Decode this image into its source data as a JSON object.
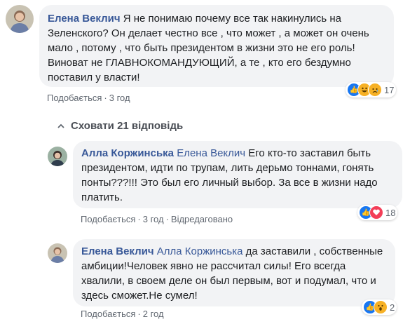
{
  "comments": [
    {
      "author": "Елена Веклич",
      "text": "Я не понимаю почему все так накинулись на Зеленского? Он делает честно все , что может , а может он очень мало , потому , что быть президентом в жизни это не его роль!Виноват не ГЛАВНОКОМАНДУЮЩИЙ, а те , кто его бездумно поставил у власти!",
      "like_label": "Подобається",
      "time": "3 год",
      "reactions": {
        "icons": [
          "like-icon",
          "laugh-icon",
          "sad-icon"
        ],
        "count": "17"
      }
    },
    {
      "author": "Алла Коржинська",
      "mention": "Елена Веклич",
      "text": "Его кто-то заставил быть президентом, идти по трупам, лить дерьмо тоннами, гонять понты???!!! Это был его личный выбор. За все в жизни надо платить.",
      "like_label": "Подобається",
      "time": "3 год",
      "edited": "Відредаговано",
      "reactions": {
        "icons": [
          "like-icon",
          "love-icon"
        ],
        "count": "18"
      }
    },
    {
      "author": "Елена Веклич",
      "mention": "Алла Коржинська",
      "text": "да заставили , собственные амбиции!Человек явно не рассчитал силы! Его всегда хвалили, в своем деле он был первым, вот и подумал, что и здесь сможет.Не сумел!",
      "like_label": "Подобається",
      "time": "2 год",
      "reactions": {
        "icons": [
          "like-icon",
          "wow-icon"
        ],
        "count": "2"
      }
    }
  ],
  "hide_replies": "Сховати 21 відповідь",
  "colors": {
    "link": "#385898",
    "bubble": "#f2f3f5",
    "meta": "#606770",
    "like": "#1877f2",
    "love": "#f33e58",
    "yellow": "#f7b125"
  }
}
